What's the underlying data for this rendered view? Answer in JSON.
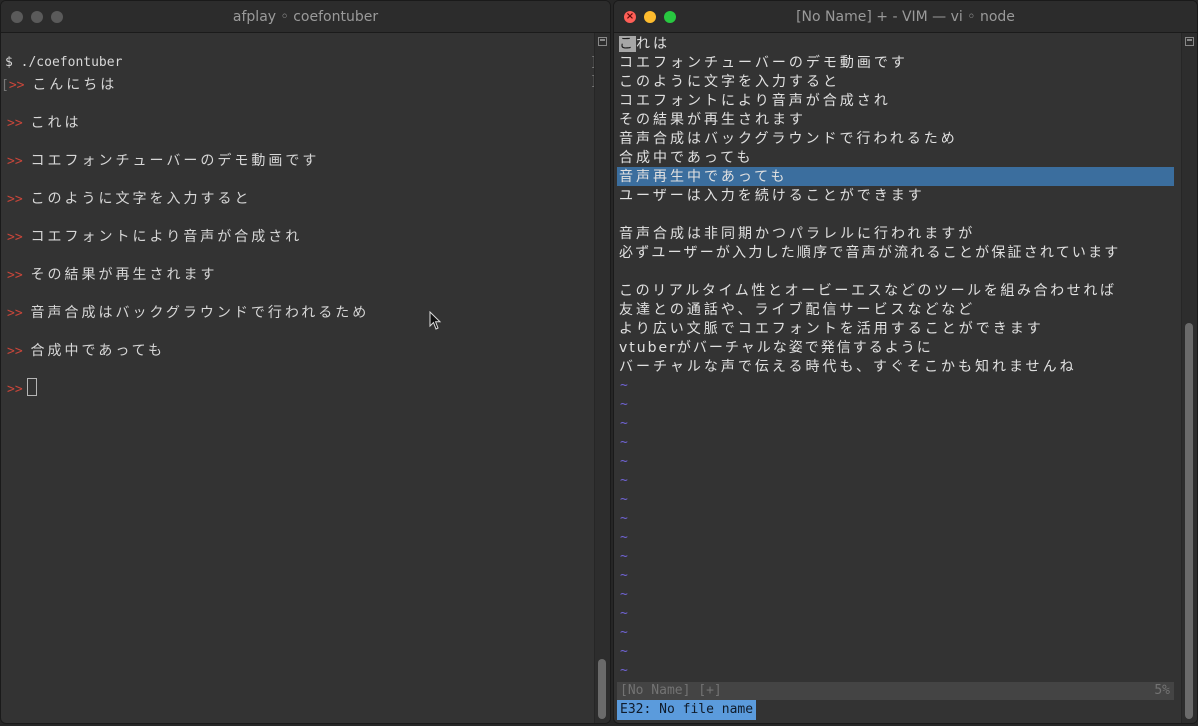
{
  "left_window": {
    "title": "afplay ◦ coefontuber",
    "command": "$ ./coefontuber",
    "prompt_symbol": ">>",
    "entries": [
      "こんにちは",
      "これは",
      "コエフォンチューバーのデモ動画です",
      "このように文字を入力すると",
      "コエフォントにより音声が合成され",
      "その結果が再生されます",
      "音声合成はバックグラウンドで行われるため",
      "合成中であっても"
    ]
  },
  "right_window": {
    "title": "[No Name] + - VIM — vi ◦ node",
    "cursor_char": "こ",
    "first_line_rest": "れは",
    "lines": [
      "コエフォンチューバーのデモ動画です",
      "このように文字を入力すると",
      "コエフォントにより音声が合成され",
      "その結果が再生されます",
      "音声合成はバックグラウンドで行われるため",
      "合成中であっても",
      "音声再生中であっても",
      "ユーザーは入力を続けることができます",
      "",
      "音声合成は非同期かつパラレルに行われますが",
      "必ずユーザーが入力した順序で音声が流れることが保証されています",
      "",
      "このリアルタイム性とオービーエスなどのツールを組み合わせれば",
      "友達との通話や、ライブ配信サービスなどなど",
      "より広い文脈でコエフォントを活用することができます",
      "vtuberがバーチャルな姿で発信するように",
      "バーチャルな声で伝える時代も、すぐそこかも知れませんね"
    ],
    "highlighted_line": "音声再生中であっても",
    "tilde": "~",
    "status_name": "[No Name] [+]",
    "status_percent": "5%",
    "error_message": "E32: No file name"
  },
  "colors": {
    "prompt": "#c8463a",
    "highlight": "#3b6e9e",
    "error_bg": "#5b9bdc",
    "tilde": "#7064d6"
  }
}
